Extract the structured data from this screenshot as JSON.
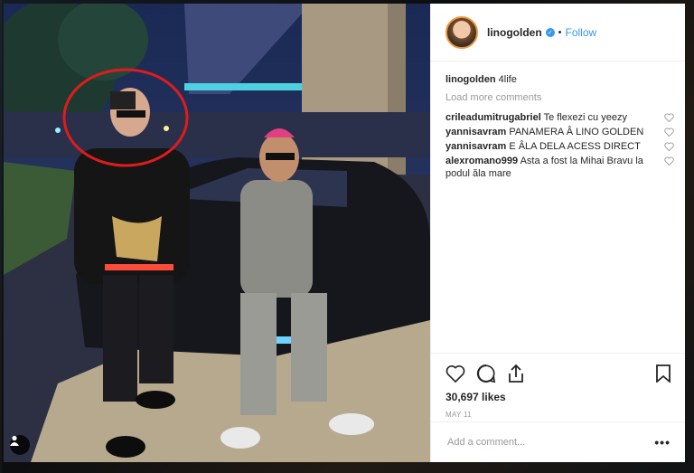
{
  "post": {
    "username": "linogolden",
    "follow_separator": "•",
    "follow_label": "Follow",
    "caption_user": "linogolden",
    "caption_text": "4life",
    "load_more_label": "Load more comments",
    "comments": [
      {
        "user": "crileadumitrugabriel",
        "text": "Te flexezi cu yeezy"
      },
      {
        "user": "yannisavram",
        "text": "PANAMERA Â LINO GOLDEN"
      },
      {
        "user": "yannisavram",
        "text": "E ÂLA DELA ACESS DIRECT"
      },
      {
        "user": "alexromano999",
        "text": "Asta a fost la Mihai Bravu la podul ăla mare"
      }
    ],
    "likes": "30,697 likes",
    "date": "MAY 11",
    "add_comment_placeholder": "Add a comment...",
    "more_options": "•••"
  },
  "icons": [
    "heart-icon",
    "comment-icon",
    "share-icon",
    "bookmark-icon",
    "verified-badge-icon",
    "user-tag-icon",
    "more-options-icon"
  ],
  "colors": {
    "accent": "#3897f0",
    "muted": "#999999",
    "text": "#262626",
    "annotation_circle": "#e01b1b"
  }
}
